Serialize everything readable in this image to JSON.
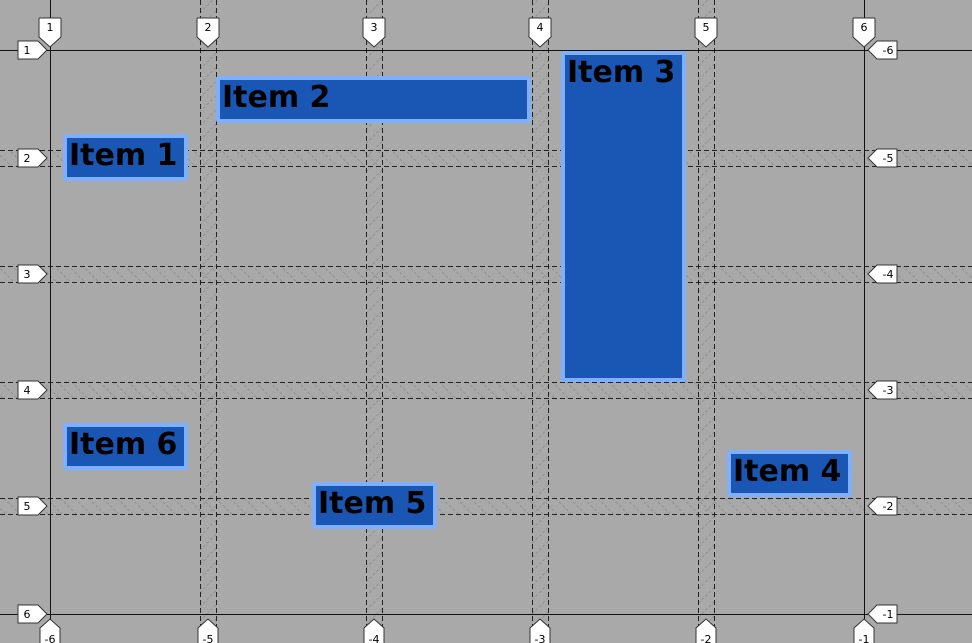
{
  "grid": {
    "colors": {
      "background": "#a9a9a9",
      "line": "#1a1a1a",
      "item_fill": "#1a56b3",
      "item_border": "#7fb0ff",
      "badge_fill": "#ffffff"
    },
    "column_labels_top": [
      "1",
      "2",
      "3",
      "4",
      "5",
      "6"
    ],
    "column_labels_bottom": [
      "-6",
      "-5",
      "-4",
      "-3",
      "-2",
      "-1"
    ],
    "row_labels_left": [
      "1",
      "2",
      "3",
      "4",
      "5",
      "6"
    ],
    "row_labels_right": [
      "-6",
      "-5",
      "-4",
      "-3",
      "-2",
      "-1"
    ]
  },
  "items": [
    {
      "label": "Item 1",
      "column": "1 / 2",
      "row": "2 / 3"
    },
    {
      "label": "Item 2",
      "column": "2 / 4",
      "row": "1 / 2"
    },
    {
      "label": "Item 3",
      "column": "4 / 5",
      "row": "1 / 4"
    },
    {
      "label": "Item 4",
      "column": "5 / 6",
      "row": "4 / 5"
    },
    {
      "label": "Item 5",
      "column": "3 / 4",
      "row": "4 / 5"
    },
    {
      "label": "Item 6",
      "column": "1 / 2",
      "row": "4 / 5"
    }
  ]
}
